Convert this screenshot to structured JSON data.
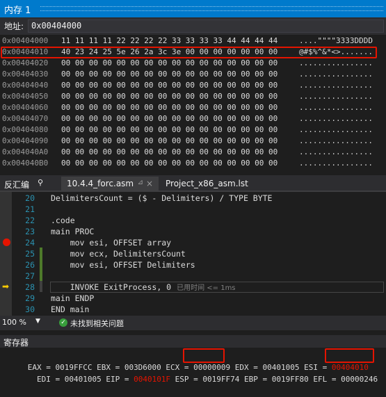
{
  "memory_window": {
    "title": "内存 1",
    "address_label": "地址:",
    "address_value": "0x00404000",
    "rows": [
      {
        "addr": "0x00404000",
        "hex": "11 11 11 11 22 22 22 22 33 33 33 33 44 44 44 44",
        "ascii": "....\"\"\"\"3333DDDD"
      },
      {
        "addr": "0x00404010",
        "hex": "40 23 24 25 5e 26 2a 3c 3e 00 00 00 00 00 00 00",
        "ascii": "@#$%^&*<>......."
      },
      {
        "addr": "0x00404020",
        "hex": "00 00 00 00 00 00 00 00 00 00 00 00 00 00 00 00",
        "ascii": "................"
      },
      {
        "addr": "0x00404030",
        "hex": "00 00 00 00 00 00 00 00 00 00 00 00 00 00 00 00",
        "ascii": "................"
      },
      {
        "addr": "0x00404040",
        "hex": "00 00 00 00 00 00 00 00 00 00 00 00 00 00 00 00",
        "ascii": "................"
      },
      {
        "addr": "0x00404050",
        "hex": "00 00 00 00 00 00 00 00 00 00 00 00 00 00 00 00",
        "ascii": "................"
      },
      {
        "addr": "0x00404060",
        "hex": "00 00 00 00 00 00 00 00 00 00 00 00 00 00 00 00",
        "ascii": "................"
      },
      {
        "addr": "0x00404070",
        "hex": "00 00 00 00 00 00 00 00 00 00 00 00 00 00 00 00",
        "ascii": "................"
      },
      {
        "addr": "0x00404080",
        "hex": "00 00 00 00 00 00 00 00 00 00 00 00 00 00 00 00",
        "ascii": "................"
      },
      {
        "addr": "0x00404090",
        "hex": "00 00 00 00 00 00 00 00 00 00 00 00 00 00 00 00",
        "ascii": "................"
      },
      {
        "addr": "0x004040A0",
        "hex": "00 00 00 00 00 00 00 00 00 00 00 00 00 00 00 00",
        "ascii": "................"
      },
      {
        "addr": "0x004040B0",
        "hex": "00 00 00 00 00 00 00 00 00 00 00 00 00 00 00 00",
        "ascii": "................"
      }
    ]
  },
  "tabs": {
    "disassembly": "反汇编",
    "pin_icon": "pin-icon",
    "active": "10.4.4_forc.asm",
    "other": "Project_x86_asm.lst",
    "close_glyph": "×",
    "pin_glyph": "⊿"
  },
  "editor": {
    "lines": [
      {
        "num": "20",
        "text": "DelimitersCount = ($ - Delimiters) / TYPE BYTE"
      },
      {
        "num": "21",
        "text": ""
      },
      {
        "num": "22",
        "text": ".code"
      },
      {
        "num": "23",
        "text": "main PROC"
      },
      {
        "num": "24",
        "text": "    mov esi, OFFSET array"
      },
      {
        "num": "25",
        "text": "    mov ecx, DelimitersCount"
      },
      {
        "num": "26",
        "text": "    mov esi, OFFSET Delimiters"
      },
      {
        "num": "27",
        "text": ""
      },
      {
        "num": "28",
        "text": "    INVOKE ExitProcess, 0"
      },
      {
        "num": "29",
        "text": "main ENDP"
      },
      {
        "num": "30",
        "text": "END main"
      }
    ],
    "elapsed_hint": "已用时间 <= 1ms"
  },
  "status": {
    "zoom": "100 %",
    "issues": "未找到相关问题"
  },
  "registers": {
    "title": "寄存器",
    "line1_a": "  EAX = 0019FFCC EBX = 003D6000 ECX = ",
    "ecx": "00000009",
    "line1_b": " EDX = 00401005 ESI = ",
    "esi": "00404010",
    "line2_a": "    EDI = 00401005 EIP = ",
    "eip": "0040101F",
    "line2_b": " ESP = 0019FF74 EBP = 0019FF80 EFL = 00000246"
  },
  "colors": {
    "accent": "#007acc",
    "highlight_red": "#e51400",
    "line_number": "#2b91af",
    "change_bar": "#4e7a2a"
  }
}
